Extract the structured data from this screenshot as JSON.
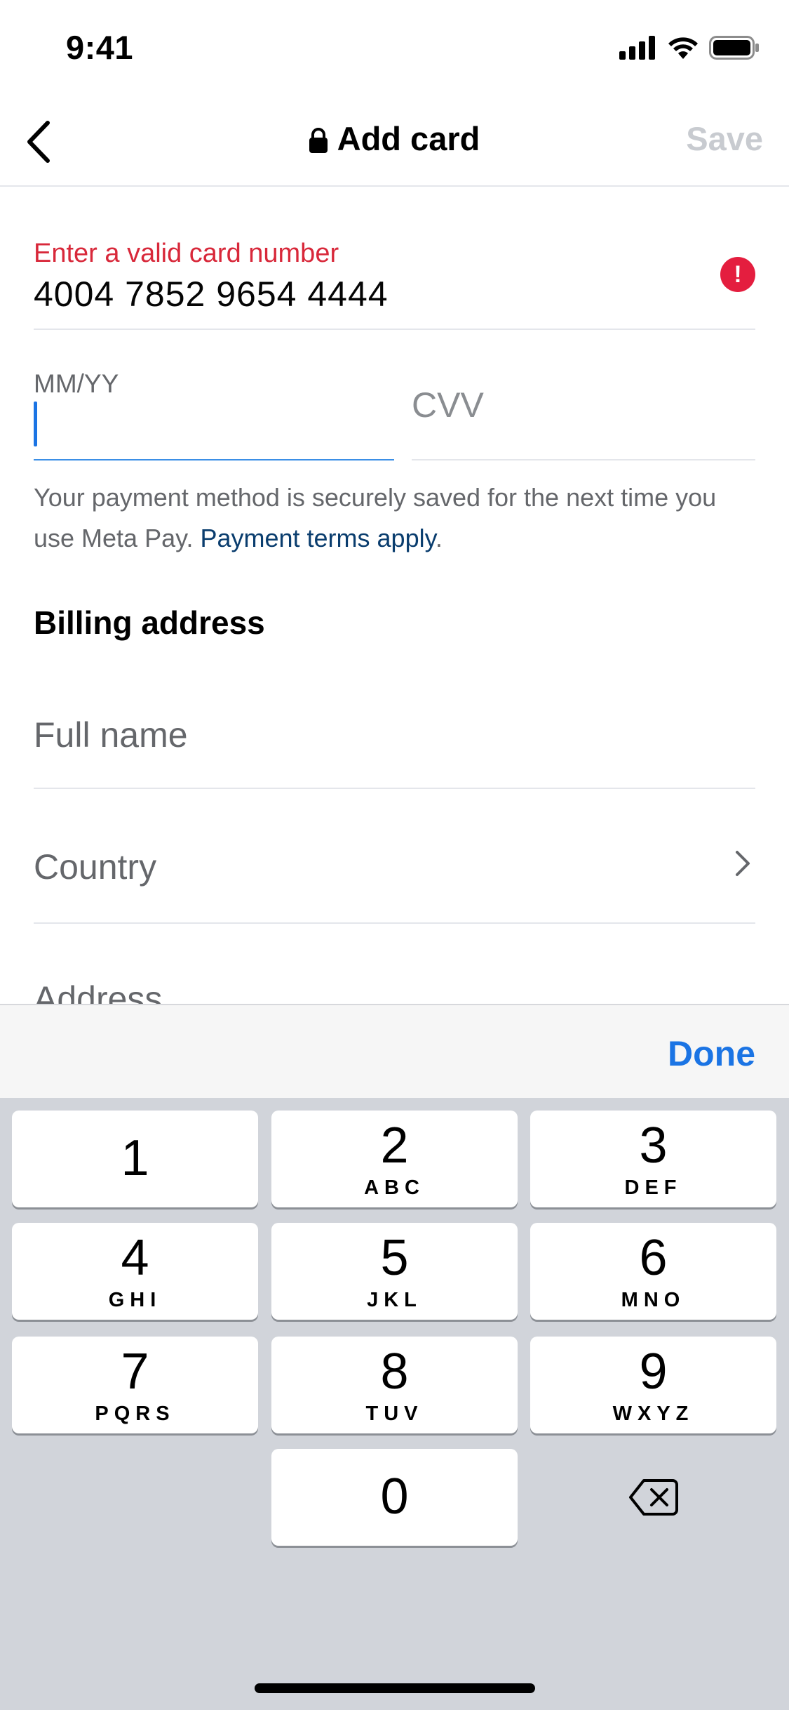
{
  "status_bar": {
    "time": "9:41",
    "icons": [
      "cellular-signal-icon",
      "wifi-icon",
      "battery-icon"
    ]
  },
  "nav": {
    "back_icon": "chevron-left-icon",
    "title_icon": "lock-icon",
    "title": "Add card",
    "save_label": "Save"
  },
  "card_number": {
    "error": "Enter a valid card number",
    "value": "4004 7852 9654 4444",
    "error_icon_glyph": "!"
  },
  "expiry": {
    "label": "MM/YY",
    "value": ""
  },
  "cvv": {
    "placeholder": "CVV"
  },
  "note": {
    "text": "Your payment method is securely saved for the next time you use Meta Pay. ",
    "link": "Payment terms apply",
    "suffix": "."
  },
  "billing": {
    "title": "Billing address",
    "full_name_placeholder": "Full name",
    "country_placeholder": "Country",
    "address_placeholder": "Address"
  },
  "keyboard": {
    "done_label": "Done",
    "keys": [
      {
        "num": "1",
        "letters": ""
      },
      {
        "num": "2",
        "letters": "ABC"
      },
      {
        "num": "3",
        "letters": "DEF"
      },
      {
        "num": "4",
        "letters": "GHI"
      },
      {
        "num": "5",
        "letters": "JKL"
      },
      {
        "num": "6",
        "letters": "MNO"
      },
      {
        "num": "7",
        "letters": "PQRS"
      },
      {
        "num": "8",
        "letters": "TUV"
      },
      {
        "num": "9",
        "letters": "WXYZ"
      },
      {
        "num": "0",
        "letters": ""
      }
    ],
    "delete_icon": "backspace-icon"
  },
  "colors": {
    "accent": "#1b74e4",
    "error": "#e41e3f",
    "link": "#0a3d6e",
    "keypad_bg": "#d1d4da"
  }
}
